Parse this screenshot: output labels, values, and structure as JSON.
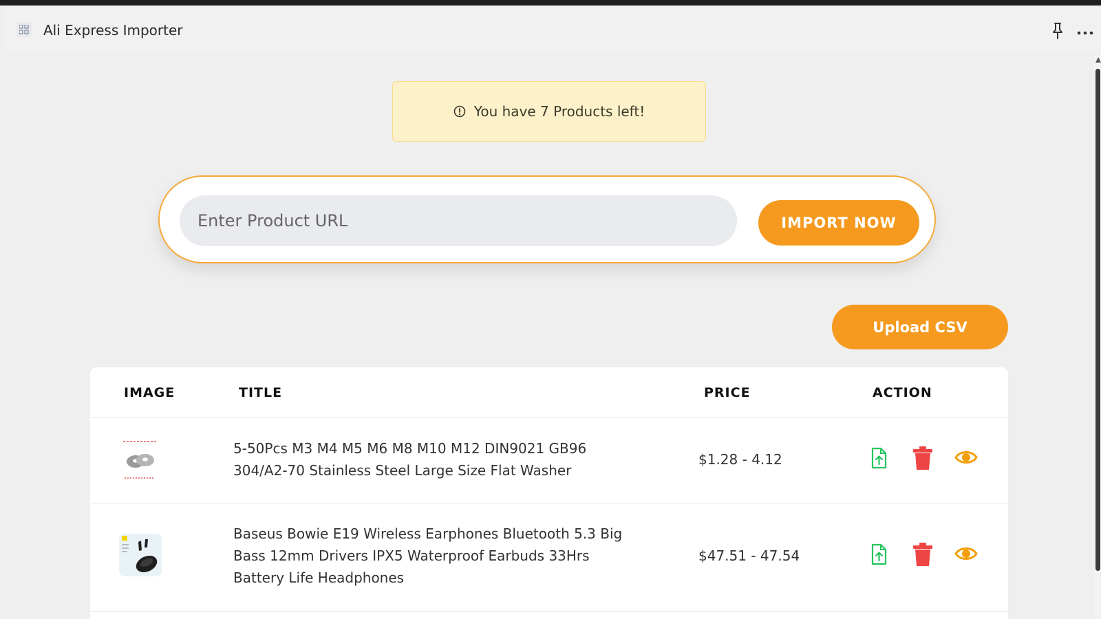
{
  "app": {
    "title": "Ali Express Importer"
  },
  "alert": {
    "text": "You have 7 Products left!"
  },
  "import": {
    "placeholder": "Enter Product URL",
    "button_label": "IMPORT NOW"
  },
  "csv": {
    "button_label": "Upload CSV"
  },
  "table": {
    "columns": [
      "IMAGE",
      "TITLE",
      "PRICE",
      "ACTION"
    ],
    "rows": [
      {
        "title": "5-50Pcs M3 M4 M5 M6 M8 M10 M12 DIN9021 GB96 304/A2-70 Stainless Steel Large Size Flat Washer",
        "price": "$1.28 - 4.12"
      },
      {
        "title": "Baseus Bowie E19 Wireless Earphones Bluetooth 5.3 Big Bass 12mm Drivers IPX5 Waterproof Earbuds 33Hrs Battery Life Headphones",
        "price": "$47.51 - 47.54"
      }
    ]
  },
  "icons": {
    "export": "file-upload-icon",
    "delete": "trash-icon",
    "view": "eye-icon",
    "pin": "pin-icon",
    "more": "more-icon",
    "alert": "info-circle-icon"
  },
  "colors": {
    "accent": "#f59a1f",
    "alert_bg": "#fdf1c9",
    "export_green": "#22c55e",
    "delete_red": "#ef4444",
    "view_orange": "#f59e0b"
  }
}
